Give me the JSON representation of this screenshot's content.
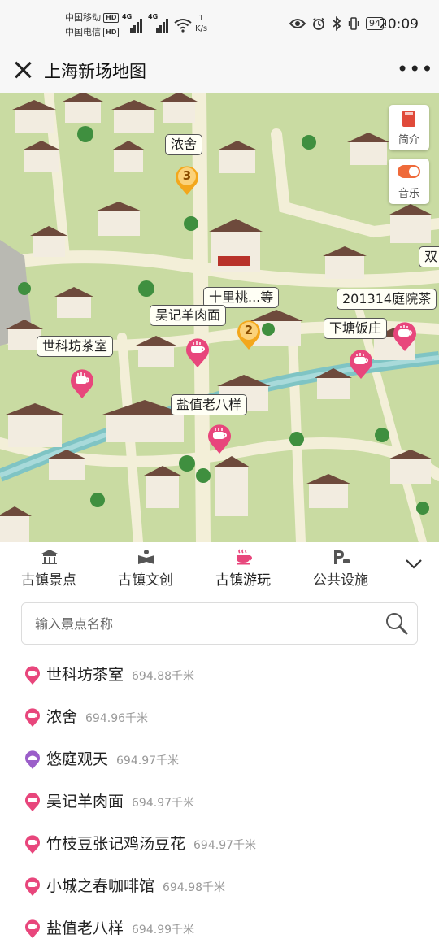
{
  "status_bar": {
    "carrier1": "中国移动",
    "carrier2": "中国电信",
    "hd": "HD",
    "net1": "4G",
    "net2": "4G",
    "speed_value": "1",
    "speed_unit": "K/s",
    "battery": "94",
    "time": "20:09"
  },
  "header": {
    "title": "上海新场地图"
  },
  "map": {
    "labels": {
      "nongshe": "浓舍",
      "shilitao": "十里桃...等",
      "wuji": "吴记羊肉面",
      "yard": "201314庭院茶",
      "shike": "世科坊茶室",
      "xiatang": "下塘饭庄",
      "yanzhi": "盐值老八样",
      "edge_char": "双"
    },
    "clusters": {
      "c3": "3",
      "c2": "2"
    },
    "side_buttons": {
      "intro": "简介",
      "music": "音乐"
    },
    "colors": {
      "ground": "#c9dba2",
      "road": "#f3efd8",
      "water": "#7fc4c4",
      "roof": "#6e4a3c",
      "wall": "#f2ece0",
      "pin_pink": "#e8467c",
      "cluster_orange": "#f3a71c"
    }
  },
  "tabs": [
    {
      "label": "古镇景点",
      "icon": "temple-icon"
    },
    {
      "label": "古镇文创",
      "icon": "book-icon"
    },
    {
      "label": "古镇游玩",
      "icon": "teacup-icon"
    },
    {
      "label": "公共设施",
      "icon": "parking-icon"
    }
  ],
  "active_tab": "古镇游玩",
  "search": {
    "placeholder": "输入景点名称",
    "value": ""
  },
  "results": [
    {
      "name": "世科坊茶室",
      "distance": "694.88千米",
      "pin": "pink"
    },
    {
      "name": "浓舍",
      "distance": "694.96千米",
      "pin": "pink"
    },
    {
      "name": "悠庭观天",
      "distance": "694.97千米",
      "pin": "purple"
    },
    {
      "name": "吴记羊肉面",
      "distance": "694.97千米",
      "pin": "pink"
    },
    {
      "name": "竹枝豆张记鸡汤豆花",
      "distance": "694.97千米",
      "pin": "pink"
    },
    {
      "name": "小城之春咖啡馆",
      "distance": "694.98千米",
      "pin": "pink"
    },
    {
      "name": "盐值老八样",
      "distance": "694.99千米",
      "pin": "pink"
    }
  ]
}
